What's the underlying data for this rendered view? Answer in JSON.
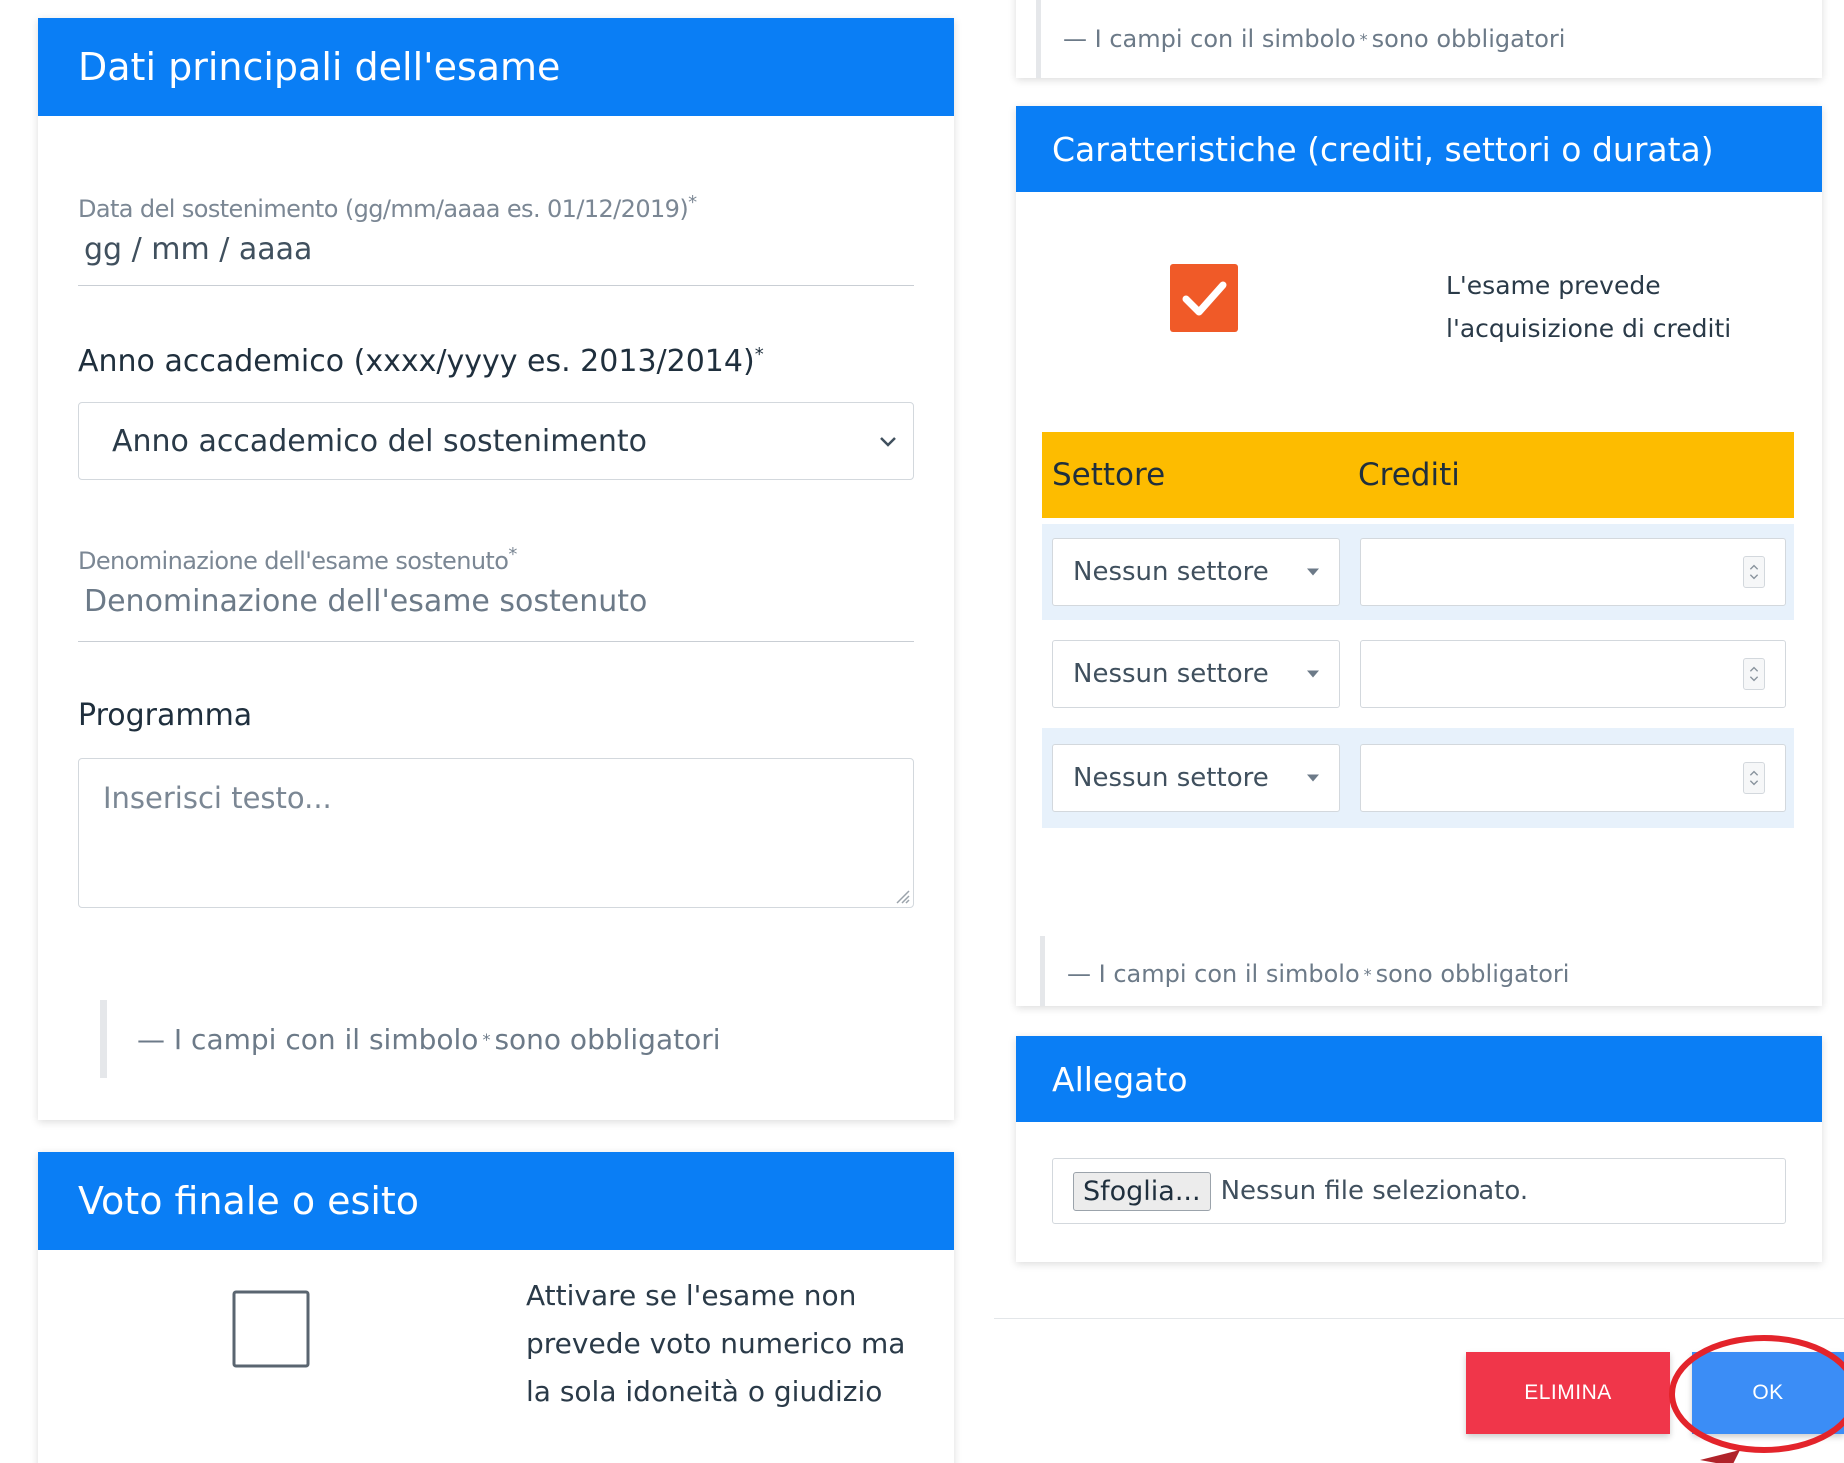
{
  "main_card": {
    "title": "Dati principali dell'esame",
    "date_label": "Data del sostenimento (gg/mm/aaaa es. 01/12/2019)",
    "date_placeholder": "gg / mm / aaaa",
    "year_label": "Anno accademico (xxxx/yyyy es. 2013/2014)",
    "year_select_value": "Anno accademico del sostenimento",
    "exam_name_label": "Denominazione dell'esame sostenuto",
    "exam_name_placeholder": "Denominazione dell'esame sostenuto",
    "program_label": "Programma",
    "program_placeholder": "Inserisci testo...",
    "required_note_prefix": "— I campi con il simbolo",
    "required_note_suffix": "sono obbligatori",
    "asterisk": "*"
  },
  "grade_card": {
    "title": "Voto finale o esito",
    "checkbox_label": "Attivare se l'esame non prevede voto numerico ma la sola idoneità o giudizio",
    "checked": false
  },
  "top_note": {
    "prefix": "— I campi con il simbolo",
    "suffix": "sono obbligatori"
  },
  "features_card": {
    "title": "Caratteristiche (crediti, settori o durata)",
    "credits_checkbox_label": "L'esame prevede l'acquisizione di crediti",
    "credits_checked": true,
    "table_headers": {
      "sector": "Settore",
      "credits": "Crediti"
    },
    "rows": [
      {
        "sector": "Nessun settore",
        "credits": ""
      },
      {
        "sector": "Nessun settore",
        "credits": ""
      },
      {
        "sector": "Nessun settore",
        "credits": ""
      }
    ],
    "note_prefix": "— I campi con il simbolo",
    "note_suffix": "sono obbligatori"
  },
  "attachment_card": {
    "title": "Allegato",
    "browse_label": "Sfoglia...",
    "no_file_text": "Nessun file selezionato."
  },
  "actions": {
    "delete_label": "ELIMINA",
    "ok_label": "OK"
  },
  "colors": {
    "header_blue": "#0a7ef5",
    "table_header_yellow": "#fdbc00",
    "checkbox_orange": "#f05a28",
    "delete_red": "#f0364a",
    "ok_blue": "#3b8df6",
    "annotation_red": "#e3242b"
  },
  "icons": [
    "chevron-down-icon",
    "checkmark-icon",
    "dropdown-triangle-icon",
    "spinner-arrows-icon",
    "resize-grip-icon"
  ]
}
